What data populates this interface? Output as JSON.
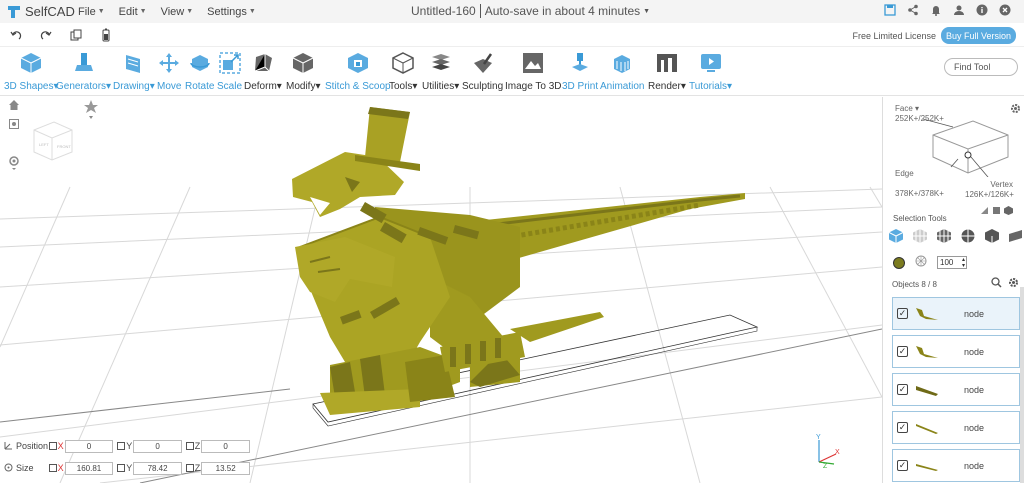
{
  "app": {
    "name": "SelfCAD",
    "brand_color": "#3a9ad6"
  },
  "menu": [
    {
      "label": "File"
    },
    {
      "label": "Edit"
    },
    {
      "label": "View"
    },
    {
      "label": "Settings"
    }
  ],
  "document": {
    "title": "Untitled-160",
    "autosave": "Auto-save in about 4 minutes"
  },
  "topbar_icons": [
    "save-icon",
    "share-icon",
    "bell-icon",
    "user-icon",
    "info-icon",
    "close-icon"
  ],
  "quickbar_icons": [
    "undo-icon",
    "redo-icon",
    "copy-icon",
    "battery-icon"
  ],
  "license": {
    "text": "Free Limited License",
    "button": "Buy Full Version"
  },
  "tools": [
    {
      "label": "3D Shapes",
      "dropdown": true,
      "blue": true
    },
    {
      "label": "Generators",
      "dropdown": true,
      "blue": true
    },
    {
      "label": "Drawing",
      "dropdown": true,
      "blue": true
    },
    {
      "label": "Move",
      "dropdown": false,
      "blue": true
    },
    {
      "label": "Rotate",
      "dropdown": false,
      "blue": true
    },
    {
      "label": "Scale",
      "dropdown": false,
      "blue": true
    },
    {
      "label": "Deform",
      "dropdown": true,
      "blue": false
    },
    {
      "label": "Modify",
      "dropdown": true,
      "blue": false
    },
    {
      "label": "Stitch & Scoop",
      "dropdown": false,
      "blue": true
    },
    {
      "label": "Tools",
      "dropdown": true,
      "blue": false
    },
    {
      "label": "Utilities",
      "dropdown": true,
      "blue": false
    },
    {
      "label": "Sculpting",
      "dropdown": false,
      "blue": false
    },
    {
      "label": "Image To 3D",
      "dropdown": false,
      "blue": false
    },
    {
      "label": "3D Print",
      "dropdown": false,
      "blue": true
    },
    {
      "label": "Animation",
      "dropdown": false,
      "blue": true
    },
    {
      "label": "Render",
      "dropdown": true,
      "blue": false
    },
    {
      "label": "Tutorials",
      "dropdown": true,
      "blue": true
    }
  ],
  "find_tool": {
    "placeholder": "Find Tool"
  },
  "properties": {
    "position": {
      "label": "Position",
      "x": "0",
      "y": "0",
      "z": "0"
    },
    "size": {
      "label": "Size",
      "x": "160.81",
      "y": "78.42",
      "z": "13.52"
    },
    "axis_labels": {
      "x": "X",
      "y": "Y",
      "z": "Z"
    }
  },
  "gizmo": {
    "y": "Y",
    "x": "X",
    "z": "Z"
  },
  "selection_panel": {
    "face": {
      "label": "Face",
      "count": "252K+/252K+"
    },
    "edge": {
      "label": "Edge",
      "count": "378K+/378K+"
    },
    "vertex": {
      "label": "Vertex",
      "count": "126K+/126K+"
    },
    "selection_tools_title": "Selection Tools",
    "model_color": "#7b7b1f",
    "opacity": "100"
  },
  "objects": {
    "header": "Objects 8 / 8",
    "items": [
      {
        "name": "node",
        "checked": true,
        "selected": true
      },
      {
        "name": "node",
        "checked": true,
        "selected": false
      },
      {
        "name": "node",
        "checked": true,
        "selected": false
      },
      {
        "name": "node",
        "checked": true,
        "selected": false
      },
      {
        "name": "node",
        "checked": true,
        "selected": false
      }
    ]
  }
}
